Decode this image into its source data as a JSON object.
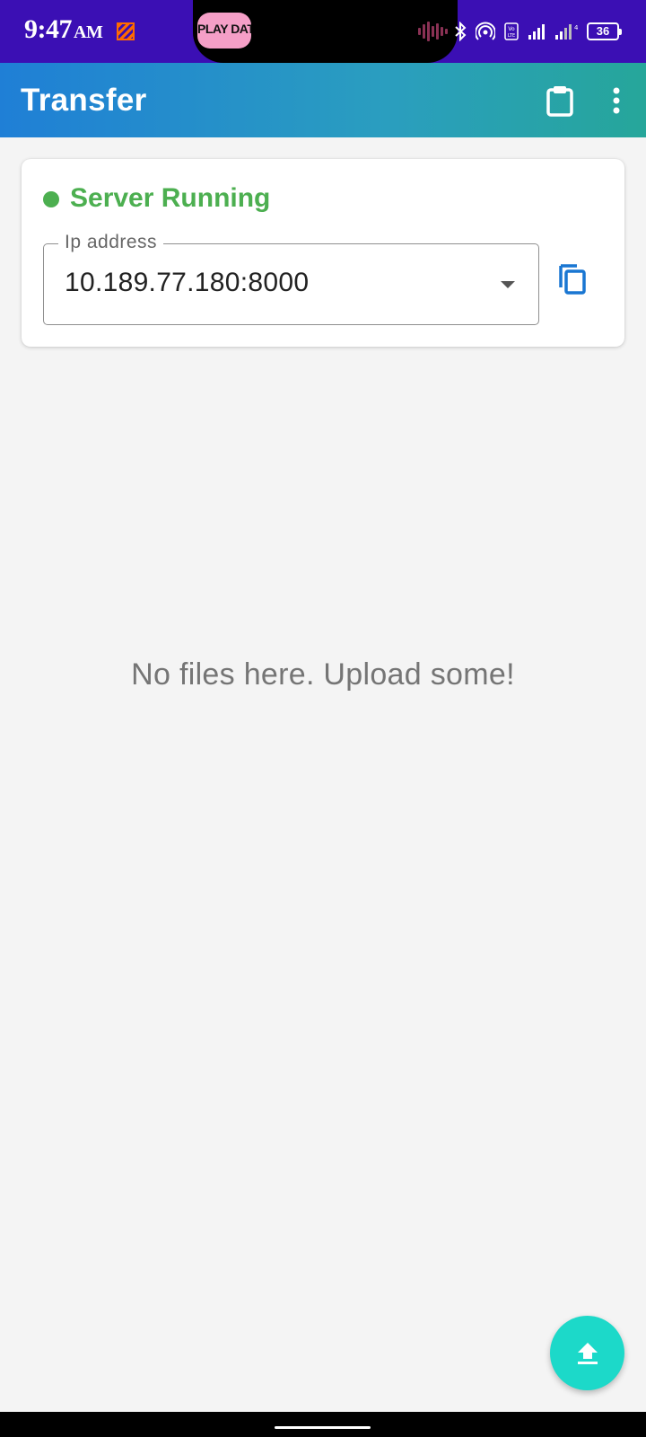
{
  "status_bar": {
    "time": "9:47",
    "ampm": "AM",
    "media_thumbnail_text": "PLAY DATE",
    "battery": "36",
    "background_color": "#3b0fb4",
    "icons": [
      "notification-icon",
      "audio-wave-icon",
      "bluetooth-icon",
      "hotspot-icon",
      "volte-icon",
      "signal-icon",
      "signal-4g-icon",
      "battery-icon"
    ]
  },
  "app_bar": {
    "title": "Transfer",
    "actions": [
      "clipboard-icon",
      "more-vert-icon"
    ]
  },
  "server": {
    "status_label": "Server Running",
    "status_color": "#4caf50",
    "ip_label": "Ip address",
    "ip_value": "10.189.77.180:8000"
  },
  "files": {
    "empty_message": "No files here. Upload some!"
  },
  "fab": {
    "icon": "upload-icon",
    "color": "#1cd9c9"
  },
  "colors": {
    "accent_blue": "#1976d2",
    "app_bar_gradient_start": "#1f7fd6",
    "app_bar_gradient_end": "#26a69a"
  }
}
